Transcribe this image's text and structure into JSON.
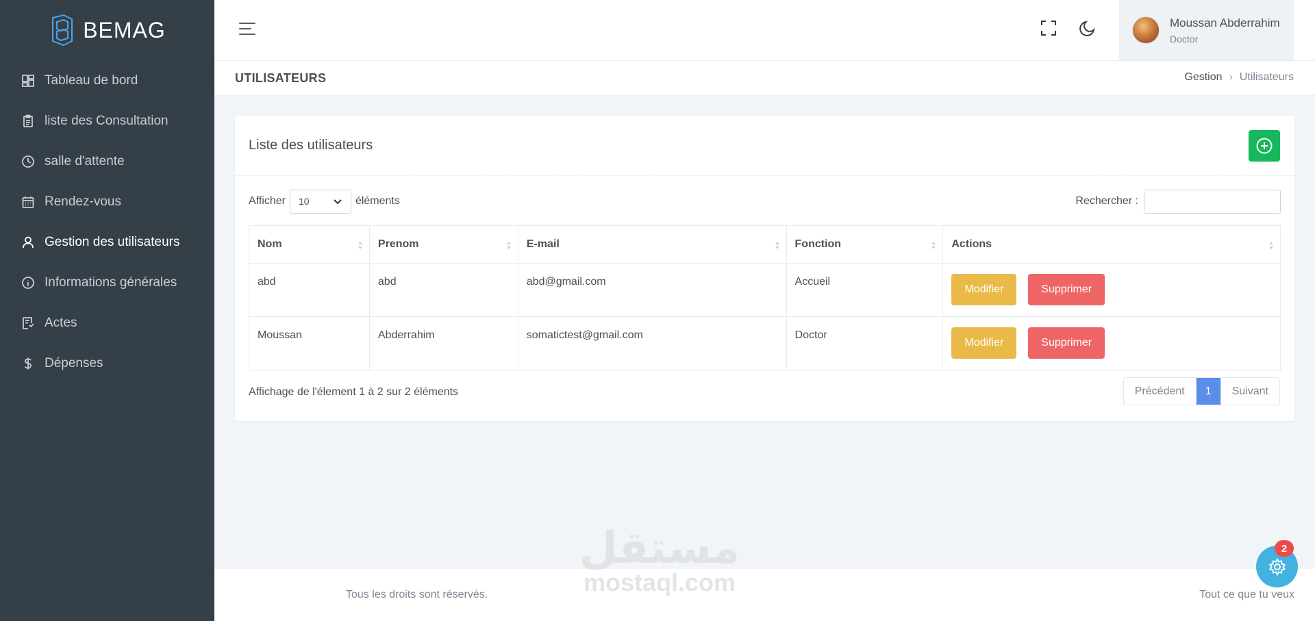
{
  "brand": {
    "name": "BEMAG"
  },
  "sidebar": {
    "items": [
      {
        "label": "Tableau de bord",
        "icon": "dashboard-icon"
      },
      {
        "label": "liste des Consultation",
        "icon": "clipboard-icon"
      },
      {
        "label": "salle d'attente",
        "icon": "clock-icon"
      },
      {
        "label": "Rendez-vous",
        "icon": "calendar-icon"
      },
      {
        "label": "Gestion des utilisateurs",
        "icon": "user-icon",
        "active": true
      },
      {
        "label": "Informations générales",
        "icon": "info-icon"
      },
      {
        "label": "Actes",
        "icon": "document-icon"
      },
      {
        "label": "Dépenses",
        "icon": "dollar-icon"
      }
    ]
  },
  "header": {
    "user": {
      "name": "Moussan Abderrahim",
      "role": "Doctor"
    }
  },
  "page": {
    "title": "UTILISATEURS",
    "breadcrumb": [
      "Gestion",
      "Utilisateurs"
    ]
  },
  "card": {
    "title": "Liste des utilisateurs",
    "show_label": "Afficher",
    "page_size": "10",
    "elements_label": "éléments",
    "search_label": "Rechercher :",
    "search_value": "",
    "columns": [
      "Nom",
      "Prenom",
      "E-mail",
      "Fonction",
      "Actions"
    ],
    "rows": [
      {
        "nom": "abd",
        "prenom": "abd",
        "email": "abd@gmail.com",
        "fonction": "Accueil"
      },
      {
        "nom": "Moussan",
        "prenom": "Abderrahim",
        "email": "somatictest@gmail.com",
        "fonction": "Doctor"
      }
    ],
    "edit_label": "Modifier",
    "delete_label": "Supprimer",
    "info_text": "Affichage de l'élement 1 à 2 sur 2 éléments",
    "pager": {
      "prev": "Précédent",
      "current": "1",
      "next": "Suivant"
    }
  },
  "footer": {
    "left": "Tous les droits sont réservés.",
    "right": "Tout ce que tu veux"
  },
  "watermark": {
    "arabic": "مستقل",
    "latin": "mostaql.com"
  },
  "settings": {
    "badge": "2"
  },
  "colors": {
    "sidebar": "#343f47",
    "add_button": "#17b75e",
    "edit_button": "#e9ba47",
    "delete_button": "#ee6566",
    "pager_active": "#5b8ee8",
    "settings_fab": "#43b2e0"
  }
}
